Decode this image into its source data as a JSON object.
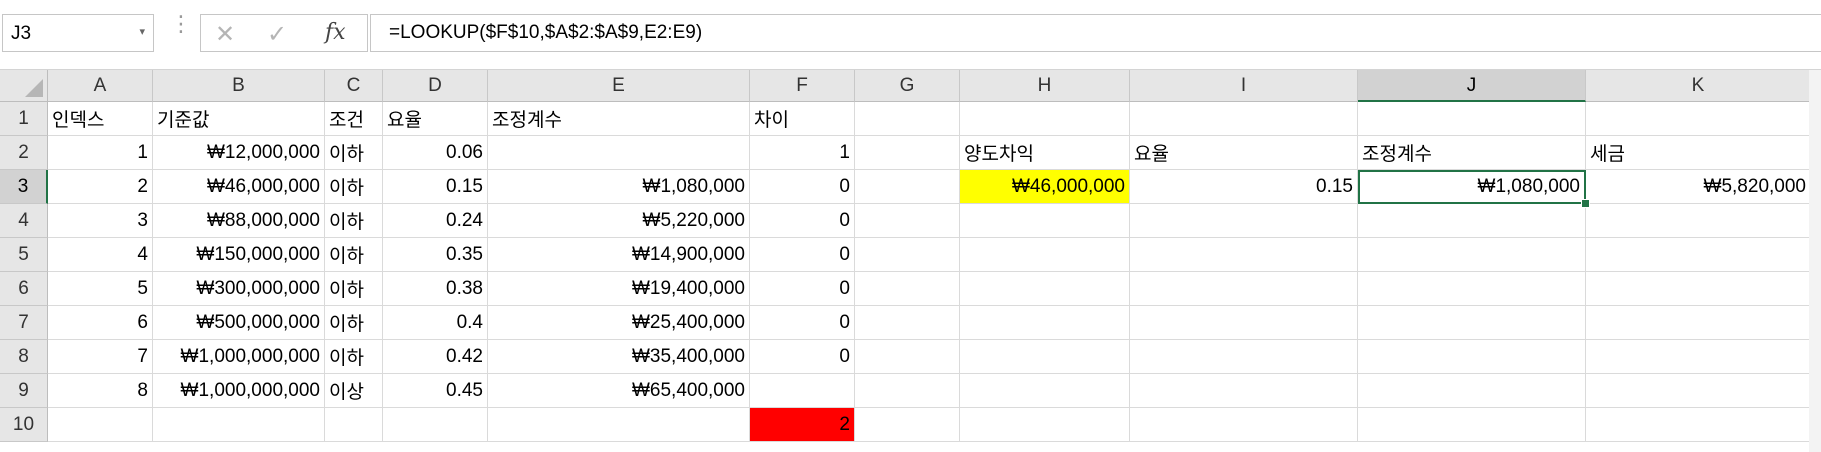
{
  "formula_bar": {
    "name_box": "J3",
    "name_box_arrow": "▾",
    "dots": "⋮",
    "cancel_icon": "✕",
    "enter_icon": "✓",
    "fx_label": "fx",
    "formula": "=LOOKUP($F$10,$A$2:$A$9,E2:E9)"
  },
  "sheet": {
    "active_cell": "J3",
    "columns": [
      "A",
      "B",
      "C",
      "D",
      "E",
      "F",
      "G",
      "H",
      "I",
      "J",
      "K"
    ],
    "rows": [
      "1",
      "2",
      "3",
      "4",
      "5",
      "6",
      "7",
      "8",
      "9",
      "10"
    ],
    "cells": {
      "A1": "인덱스",
      "B1": "기준값",
      "C1": "조건",
      "D1": "요율",
      "E1": "조정계수",
      "F1": "차이",
      "A2": "1",
      "B2": "₩12,000,000",
      "C2": "이하",
      "D2": "0.06",
      "F2": "1",
      "H2": "양도차익",
      "I2": "요율",
      "J2": "조정계수",
      "K2": "세금",
      "A3": "2",
      "B3": "₩46,000,000",
      "C3": "이하",
      "D3": "0.15",
      "E3": "₩1,080,000",
      "F3": "0",
      "H3": "₩46,000,000",
      "I3": "0.15",
      "J3": "₩1,080,000",
      "K3": "₩5,820,000",
      "A4": "3",
      "B4": "₩88,000,000",
      "C4": "이하",
      "D4": "0.24",
      "E4": "₩5,220,000",
      "F4": "0",
      "A5": "4",
      "B5": "₩150,000,000",
      "C5": "이하",
      "D5": "0.35",
      "E5": "₩14,900,000",
      "F5": "0",
      "A6": "5",
      "B6": "₩300,000,000",
      "C6": "이하",
      "D6": "0.38",
      "E6": "₩19,400,000",
      "F6": "0",
      "A7": "6",
      "B7": "₩500,000,000",
      "C7": "이하",
      "D7": "0.4",
      "E7": "₩25,400,000",
      "F7": "0",
      "A8": "7",
      "B8": "₩1,000,000,000",
      "C8": "이하",
      "D8": "0.42",
      "E8": "₩35,400,000",
      "F8": "0",
      "A9": "8",
      "B9": "₩1,000,000,000",
      "C9": "이상",
      "D9": "0.45",
      "E9": "₩65,400,000",
      "F10": "2"
    },
    "fills": {
      "H3": "#ffff00",
      "F10": "#ff0000"
    },
    "grid_color": "#dadada",
    "select_color": "#217346"
  }
}
